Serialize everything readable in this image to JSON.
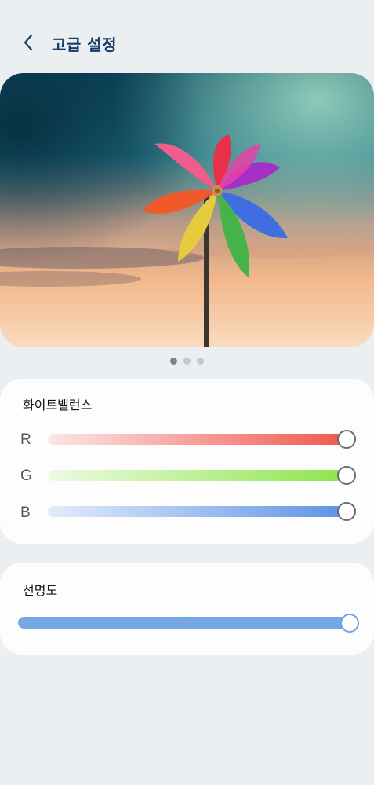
{
  "header": {
    "title": "고급 설정"
  },
  "preview": {
    "pages": 3,
    "current_page": 1
  },
  "white_balance": {
    "title": "화이트밸런스",
    "channels": [
      {
        "label": "R",
        "value_fraction": 1.0,
        "color": "#f0584c"
      },
      {
        "label": "G",
        "value_fraction": 1.0,
        "color": "#8ee44c"
      },
      {
        "label": "B",
        "value_fraction": 1.0,
        "color": "#5d93e4"
      }
    ]
  },
  "sharpness": {
    "title": "선명도",
    "value_fraction": 1.0,
    "steps": 3,
    "color": "#74a7e6"
  }
}
